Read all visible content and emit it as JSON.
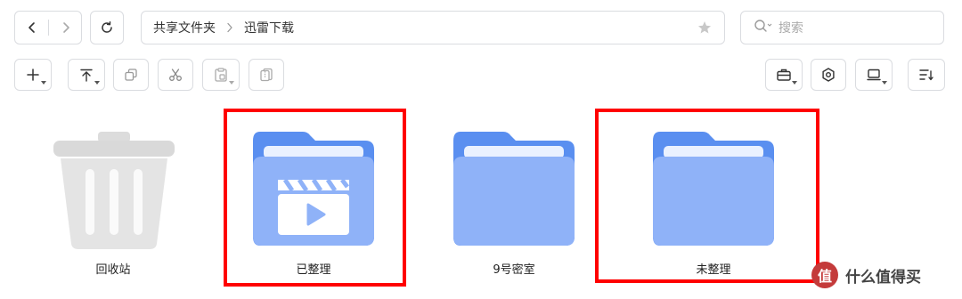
{
  "breadcrumb": {
    "root": "共享文件夹",
    "current": "迅雷下载"
  },
  "search": {
    "placeholder": "搜索"
  },
  "items": [
    {
      "label": "回收站",
      "icon": "trash-icon"
    },
    {
      "label": "已整理",
      "icon": "video-folder-icon"
    },
    {
      "label": "9号密室",
      "icon": "folder-icon"
    },
    {
      "label": "未整理",
      "icon": "folder-icon"
    }
  ],
  "watermark": {
    "logo_text": "值",
    "text": "什么值得买"
  },
  "colors": {
    "folder_back": "#5a8ff0",
    "folder_front": "#8fb2f8",
    "highlight": "#ff0000"
  }
}
